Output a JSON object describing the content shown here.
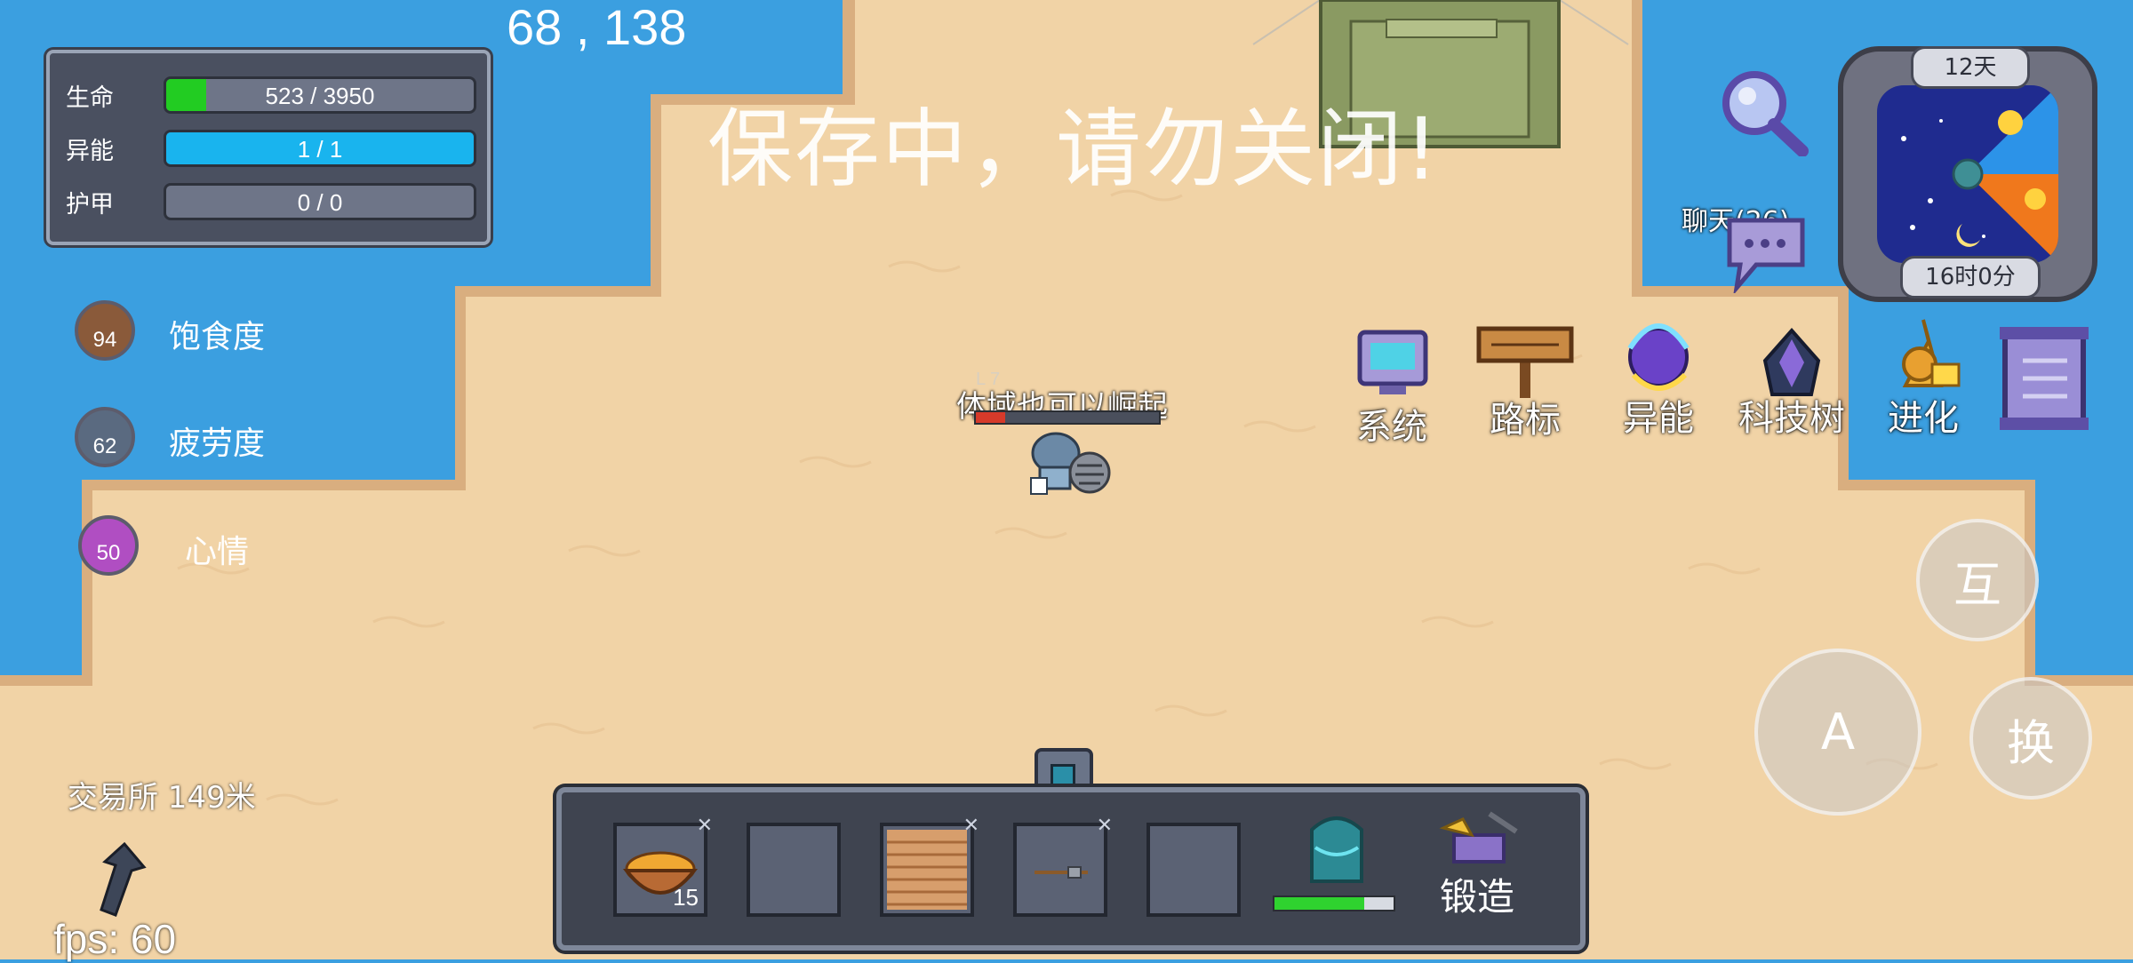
{
  "coords": "68 , 138",
  "saving_message": "保存中，请勿关闭!",
  "stats": [
    {
      "label": "生命",
      "value_text": "523 / 3950",
      "fill": 0.13,
      "color": "#22cc22"
    },
    {
      "label": "异能",
      "value_text": "1 / 1",
      "fill": 1.0,
      "color": "#19b4ee"
    },
    {
      "label": "护甲",
      "value_text": "0 / 0",
      "fill": 0.0,
      "color": "#888888"
    }
  ],
  "status": [
    {
      "label": "饱食度",
      "value": "94",
      "color": "#8a5a3a",
      "icon": "food-icon"
    },
    {
      "label": "疲劳度",
      "value": "62",
      "color": "#5a6a80",
      "icon": "fatigue-icon"
    },
    {
      "label": "心情",
      "value": "50",
      "color": "#b04ec2",
      "icon": "heart-icon"
    }
  ],
  "player": {
    "caption": "体域也可以崛起",
    "level_text": "L 7"
  },
  "menu": [
    {
      "label": "系统",
      "icon": "computer-icon"
    },
    {
      "label": "路标",
      "icon": "signpost-icon"
    },
    {
      "label": "异能",
      "icon": "magic-icon"
    },
    {
      "label": "科技树",
      "icon": "tech-tree-icon"
    },
    {
      "label": "进化",
      "icon": "evolution-icon"
    }
  ],
  "clock": {
    "day": "12天",
    "time": "16时0分"
  },
  "chat": {
    "label": "聊天(26)"
  },
  "buttons": {
    "interact": "互",
    "attack": "A",
    "swap": "换"
  },
  "trade": {
    "label": "交易所 149米"
  },
  "fps": "fps: 60",
  "hotbar": {
    "slots": [
      {
        "item": "food-bowl-icon",
        "count": "15",
        "has_x": true
      },
      {
        "item": "",
        "count": "",
        "has_x": false
      },
      {
        "item": "wood-plank-icon",
        "count": "",
        "has_x": true
      },
      {
        "item": "axe-icon",
        "count": "",
        "has_x": true
      },
      {
        "item": "",
        "count": "",
        "has_x": false
      }
    ],
    "backpack_fill": 0.75,
    "forge_label": "锻造"
  }
}
